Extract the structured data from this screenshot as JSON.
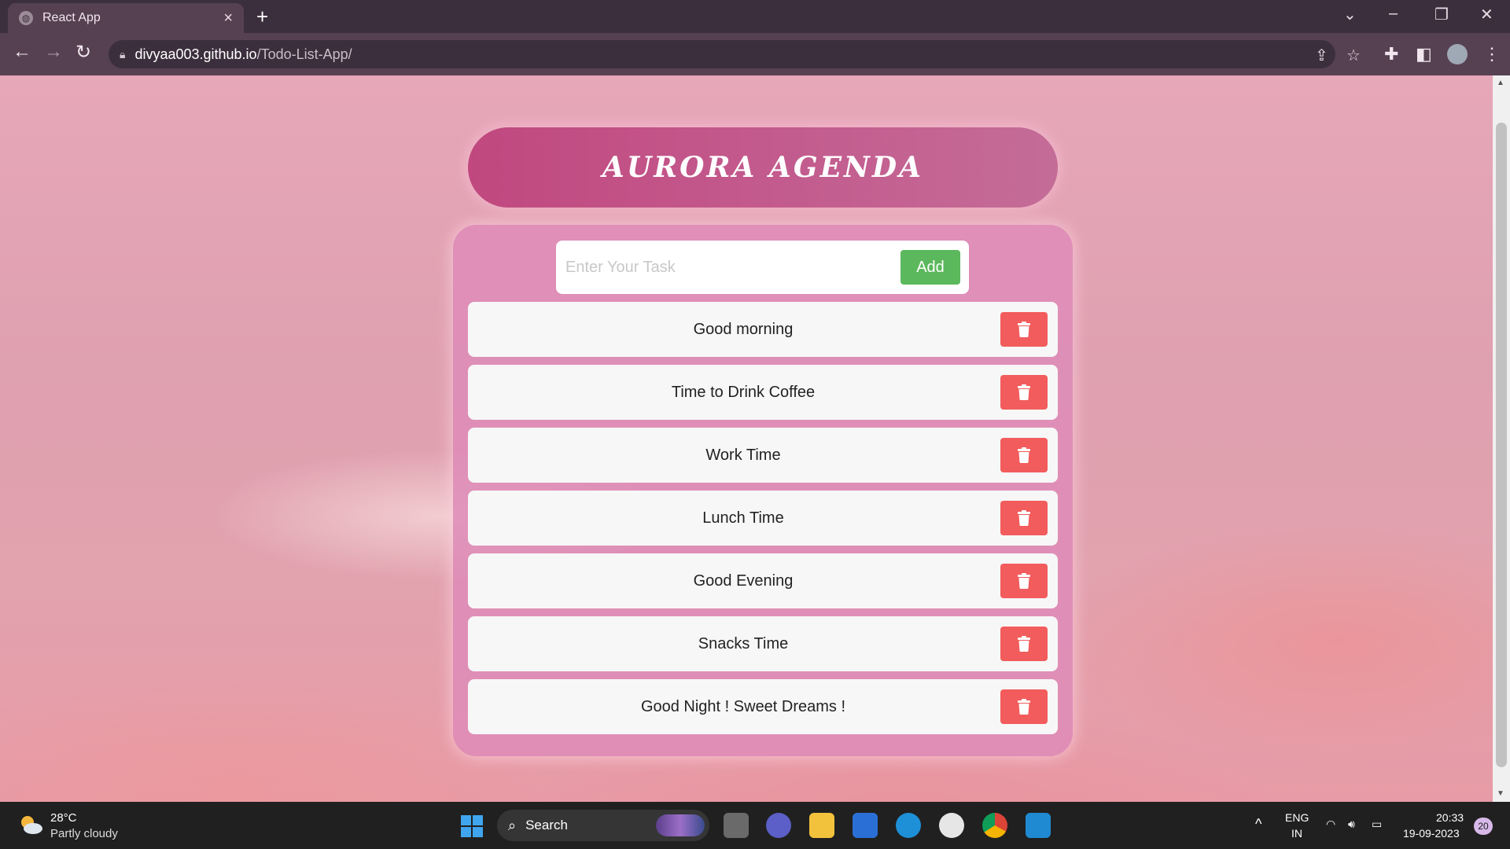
{
  "browser": {
    "tab_title": "React App",
    "url_host": "divyaa003.github.io",
    "url_path": "/Todo-List-App/"
  },
  "app": {
    "title": "AURORA AGENDA",
    "input_placeholder": "Enter Your Task",
    "input_value": "",
    "add_label": "Add",
    "tasks": [
      {
        "text": "Good morning"
      },
      {
        "text": "Time to Drink Coffee"
      },
      {
        "text": "Work Time"
      },
      {
        "text": "Lunch Time"
      },
      {
        "text": "Good Evening"
      },
      {
        "text": "Snacks Time"
      },
      {
        "text": "Good Night ! Sweet Dreams !"
      }
    ],
    "colors": {
      "header": "#c0487f",
      "add_button": "#5cb85c",
      "delete_button": "#f25c5c"
    }
  },
  "taskbar": {
    "weather_temp": "28°C",
    "weather_desc": "Partly cloudy",
    "search_label": "Search",
    "lang_line1": "ENG",
    "lang_line2": "IN",
    "time": "20:33",
    "date": "19-09-2023",
    "notification_count": "20"
  }
}
